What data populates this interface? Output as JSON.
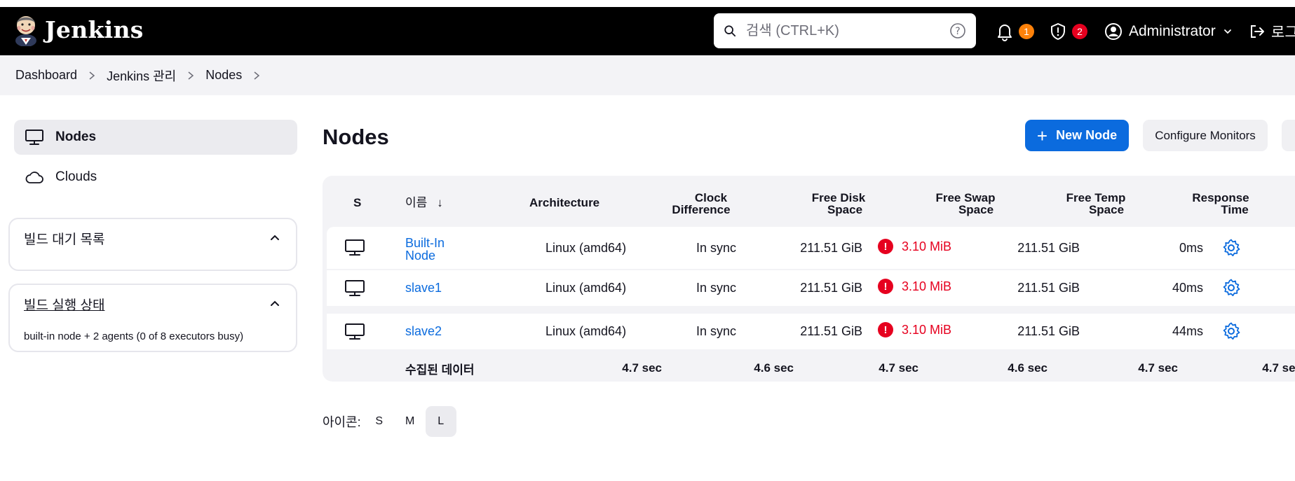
{
  "header": {
    "title": "Jenkins",
    "search_placeholder": "검색 (CTRL+K)",
    "notifications_count": "1",
    "security_count": "2",
    "user": "Administrator",
    "logout": "로그아웃"
  },
  "breadcrumb": [
    "Dashboard",
    "Jenkins 관리",
    "Nodes"
  ],
  "sidebar": {
    "items": [
      {
        "label": "Nodes",
        "icon": "computer-icon",
        "active": true
      },
      {
        "label": "Clouds",
        "icon": "cloud-icon",
        "active": false
      }
    ],
    "build_queue": {
      "title": "빌드 대기 목록"
    },
    "executor_status": {
      "title": "빌드 실행 상태",
      "text": "built-in node + 2 agents (0 of 8 executors busy)"
    }
  },
  "main": {
    "title": "Nodes",
    "new_node_label": "New Node",
    "configure_monitors_label": "Configure Monitors",
    "table": {
      "headers": {
        "status": "S",
        "name": "이름",
        "sort_arrow": "↓",
        "architecture": "Architecture",
        "clock_1": "Clock",
        "clock_2": "Difference",
        "disk_1": "Free Disk",
        "disk_2": "Space",
        "swap_1": "Free Swap",
        "swap_2": "Space",
        "temp_1": "Free Temp",
        "temp_2": "Space",
        "resp_1": "Response",
        "resp_2": "Time"
      },
      "rows": [
        {
          "name_1": "Built-In",
          "name_2": "Node",
          "architecture": "Linux (amd64)",
          "clock": "In sync",
          "disk": "211.51 GiB",
          "swap": "3.10 MiB",
          "temp": "211.51 GiB",
          "response": "0ms"
        },
        {
          "name_1": "slave1",
          "name_2": "",
          "architecture": "Linux (amd64)",
          "clock": "In sync",
          "disk": "211.51 GiB",
          "swap": "3.10 MiB",
          "temp": "211.51 GiB",
          "response": "40ms"
        },
        {
          "name_1": "slave2",
          "name_2": "",
          "architecture": "Linux (amd64)",
          "clock": "In sync",
          "disk": "211.51 GiB",
          "swap": "3.10 MiB",
          "temp": "211.51 GiB",
          "response": "44ms"
        }
      ],
      "footer": {
        "label": "수집된 데이터",
        "architecture": "4.7 sec",
        "clock": "4.6 sec",
        "disk": "4.7 sec",
        "swap": "4.6 sec",
        "temp": "4.7 sec",
        "response": "4.7 sec"
      }
    },
    "icon_size": {
      "label": "아이콘:",
      "options": [
        "S",
        "M",
        "L"
      ],
      "selected": "L"
    }
  },
  "colors": {
    "header_bg": "#000000",
    "primary": "#0b6bde",
    "danger": "#e6001f",
    "warning": "#fe820a",
    "surface": "#f3f3f6"
  }
}
